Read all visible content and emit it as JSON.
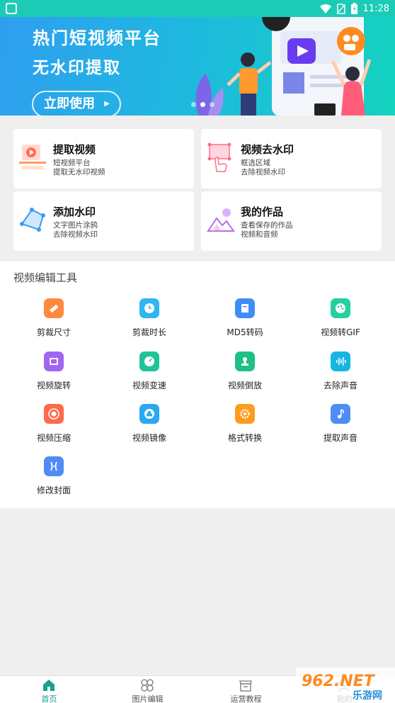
{
  "status_bar": {
    "time": "11:28"
  },
  "banner": {
    "title": "热门短视频平台",
    "subtitle": "无水印提取",
    "cta_label": "立即使用"
  },
  "features": [
    {
      "title": "提取视频",
      "line1": "短视频平台",
      "line2": "提取无水印视频",
      "icon": "video-extract-icon"
    },
    {
      "title": "视频去水印",
      "line1": "框选区域",
      "line2": "去除视频水印",
      "icon": "remove-watermark-icon"
    },
    {
      "title": "添加水印",
      "line1": "文字图片涂鸦",
      "line2": "去除视频水印",
      "icon": "add-watermark-icon"
    },
    {
      "title": "我的作品",
      "line1": "查看保存的作品",
      "line2": "视频和音频",
      "icon": "my-works-icon"
    }
  ],
  "tools": {
    "heading": "视频编辑工具",
    "items": [
      {
        "label": "剪裁尺寸",
        "icon": "ruler-icon",
        "color": "#ff8a3d"
      },
      {
        "label": "剪裁时长",
        "icon": "clock-icon",
        "color": "#2fb6f5"
      },
      {
        "label": "MD5转码",
        "icon": "doc-icon",
        "color": "#3f8ef7"
      },
      {
        "label": "视频转GIF",
        "icon": "palette-icon",
        "color": "#26cf9e"
      },
      {
        "label": "视频旋转",
        "icon": "rotate-icon",
        "color": "#a066f0"
      },
      {
        "label": "视频变速",
        "icon": "speed-icon",
        "color": "#21c49a"
      },
      {
        "label": "视频倒放",
        "icon": "stamp-icon",
        "color": "#1fbf86"
      },
      {
        "label": "去除声音",
        "icon": "sound-wave-icon",
        "color": "#17b6e0"
      },
      {
        "label": "视频压缩",
        "icon": "compress-icon",
        "color": "#ff6a4a"
      },
      {
        "label": "视频镜像",
        "icon": "mirror-icon",
        "color": "#2aa8f2"
      },
      {
        "label": "格式转换",
        "icon": "gear-icon",
        "color": "#ff9c1f"
      },
      {
        "label": "提取声音",
        "icon": "music-note-icon",
        "color": "#4f8df5"
      },
      {
        "label": "修改封面",
        "icon": "cover-icon",
        "color": "#4f8df5"
      }
    ]
  },
  "bottom_nav": [
    {
      "label": "首页",
      "icon": "home-icon",
      "active": true
    },
    {
      "label": "图片编辑",
      "icon": "photo-edit-icon",
      "active": false
    },
    {
      "label": "运营教程",
      "icon": "store-icon",
      "active": false
    },
    {
      "label": "我的",
      "icon": "profile-icon",
      "active": false
    }
  ],
  "watermark": {
    "brand": "962.NET",
    "site": "乐游网"
  }
}
